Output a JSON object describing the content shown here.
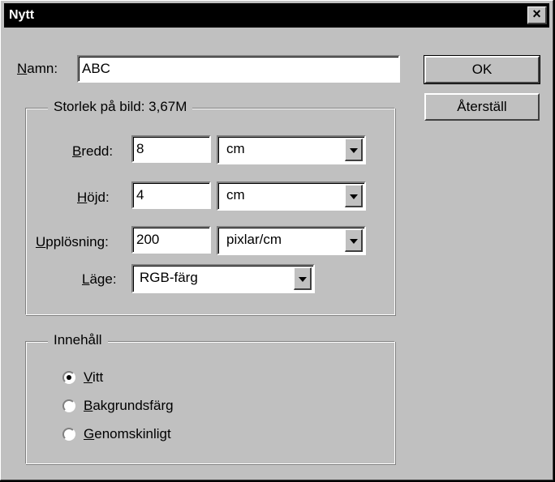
{
  "window": {
    "title": "Nytt",
    "close_label": "×"
  },
  "name_field": {
    "label_ul": "N",
    "label_rest": "amn:",
    "value": "ABC"
  },
  "buttons": {
    "ok": "OK",
    "reset": "Återställ"
  },
  "size_group": {
    "legend": "Storlek på bild:  3,67M",
    "width": {
      "label_ul": "B",
      "label_rest": "redd:",
      "value": "8",
      "unit": "cm"
    },
    "height": {
      "label_ul": "H",
      "label_rest": "öjd:",
      "value": "4",
      "unit": "cm"
    },
    "resolution": {
      "label_ul": "U",
      "label_rest": "pplösning:",
      "value": "200",
      "unit": "pixlar/cm"
    },
    "mode": {
      "label_ul": "L",
      "label_rest": "äge:",
      "value": "RGB-färg"
    }
  },
  "contents_group": {
    "legend": "Innehåll",
    "options": [
      {
        "ul": "V",
        "rest": "itt",
        "checked": true
      },
      {
        "ul": "B",
        "rest": "akgrundsfärg",
        "checked": false
      },
      {
        "ul": "G",
        "rest": "enomskinligt",
        "checked": false
      }
    ]
  }
}
